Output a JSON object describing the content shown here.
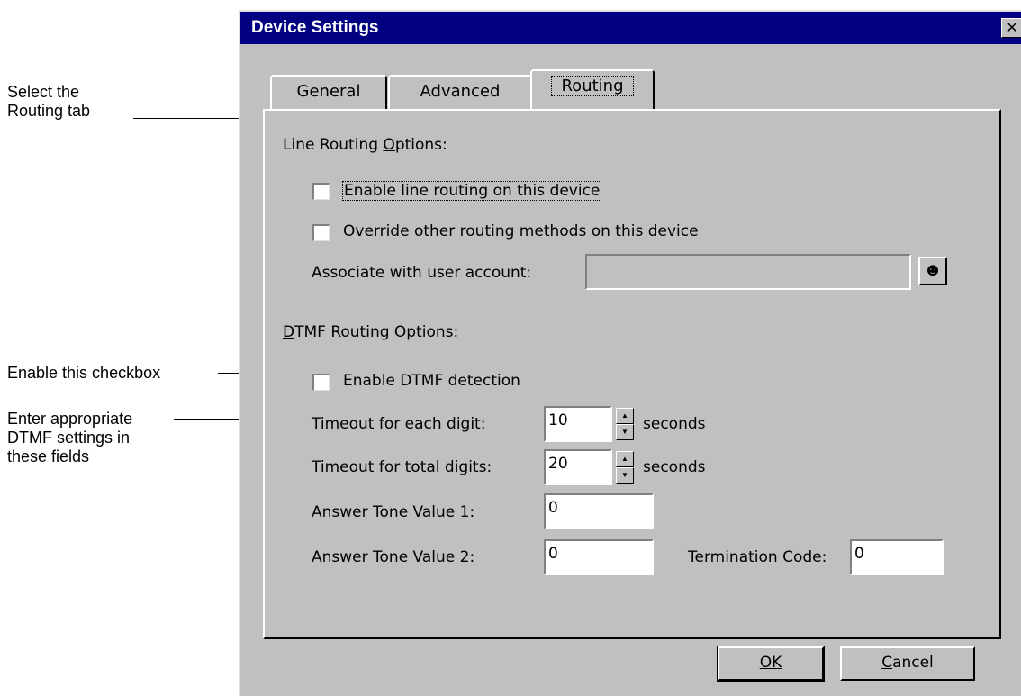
{
  "callouts": {
    "select_tab": "Select the\nRouting tab",
    "enable_checkbox": "Enable this checkbox",
    "enter_settings": "Enter appropriate\nDTMF settings in\nthese fields"
  },
  "dialog": {
    "title": "Device Settings",
    "close_glyph": "✕"
  },
  "tabs": [
    {
      "label": "General"
    },
    {
      "label": "Advanced"
    },
    {
      "label": "Routing"
    }
  ],
  "line_routing": {
    "heading": "Line Routing Options:",
    "enable_label": "Enable line routing on this device",
    "override_label": "Override other routing methods on this device",
    "associate_label": "Associate with user account:",
    "associate_value": ""
  },
  "dtmf": {
    "heading": "DTMF Routing Options:",
    "enable_label": "Enable DTMF detection",
    "timeout_digit_label": "Timeout for each digit:",
    "timeout_digit_value": "10",
    "timeout_total_label": "Timeout for total digits:",
    "timeout_total_value": "20",
    "seconds_label": "seconds",
    "tone1_label": "Answer Tone Value 1:",
    "tone1_value": "0",
    "tone2_label": "Answer Tone Value 2:",
    "tone2_value": "0",
    "termination_label": "Termination Code:",
    "termination_value": "0"
  },
  "buttons": {
    "ok": "OK",
    "cancel": "Cancel"
  },
  "icons": {
    "user_account": "user-icon",
    "spin_up": "arrow-up-icon",
    "spin_down": "arrow-down-icon"
  }
}
